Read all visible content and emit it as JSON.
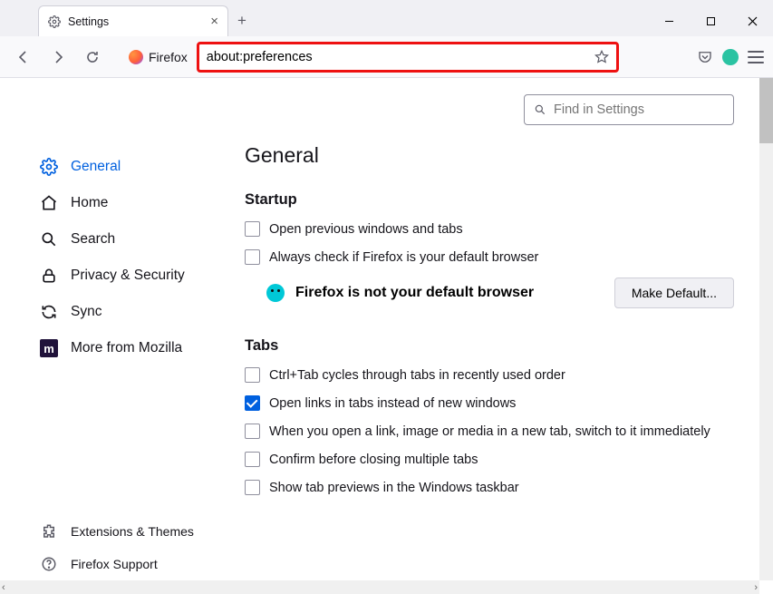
{
  "tab": {
    "title": "Settings"
  },
  "url": {
    "value": "about:preferences"
  },
  "toolbar": {
    "identity_label": "Firefox"
  },
  "search": {
    "placeholder": "Find in Settings"
  },
  "sidebar": {
    "items": [
      {
        "label": "General"
      },
      {
        "label": "Home"
      },
      {
        "label": "Search"
      },
      {
        "label": "Privacy & Security"
      },
      {
        "label": "Sync"
      },
      {
        "label": "More from Mozilla"
      }
    ],
    "footer": [
      {
        "label": "Extensions & Themes"
      },
      {
        "label": "Firefox Support"
      }
    ]
  },
  "page": {
    "title": "General",
    "startup": {
      "heading": "Startup",
      "open_previous": "Open previous windows and tabs",
      "always_check": "Always check if Firefox is your default browser",
      "not_default": "Firefox is not your default browser",
      "make_default": "Make Default..."
    },
    "tabs": {
      "heading": "Tabs",
      "ctrl_tab": "Ctrl+Tab cycles through tabs in recently used order",
      "open_links": "Open links in tabs instead of new windows",
      "switch_imm": "When you open a link, image or media in a new tab, switch to it immediately",
      "confirm_close": "Confirm before closing multiple tabs",
      "taskbar_prev": "Show tab previews in the Windows taskbar"
    }
  }
}
